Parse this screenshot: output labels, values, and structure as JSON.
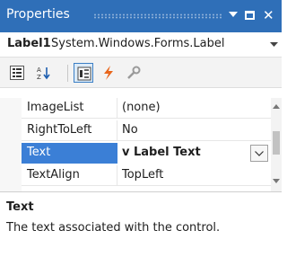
{
  "window": {
    "title": "Properties",
    "controls": [
      "chevron-down-icon",
      "maximize-icon",
      "close-icon"
    ],
    "close_glyph": "✕"
  },
  "object_selector": {
    "name": "Label1",
    "type": "System.Windows.Forms.Label"
  },
  "toolbar": {
    "buttons": [
      "categorized-icon",
      "alphabetical-icon",
      "properties-icon",
      "events-icon",
      "property-pages-icon"
    ],
    "active": "properties-icon"
  },
  "grid": {
    "rows": [
      {
        "name": "ImageList",
        "value": "(none)"
      },
      {
        "name": "RightToLeft",
        "value": "No"
      },
      {
        "name": "Text",
        "value": "v Label Text",
        "selected": true
      },
      {
        "name": "TextAlign",
        "value": "TopLeft"
      }
    ]
  },
  "description": {
    "title": "Text",
    "text": "The text associated with the control."
  },
  "colors": {
    "title_bar": "#2f6fb8",
    "selection": "#3b7fd6",
    "event_icon": "#e8661c"
  }
}
